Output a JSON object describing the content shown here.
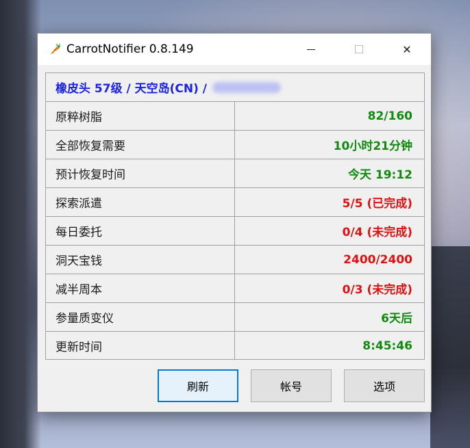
{
  "window": {
    "title": "CarrotNotifier 0.8.149",
    "controls": {
      "minimize": "minimize",
      "maximize": "maximize",
      "close": "✕"
    }
  },
  "header": {
    "text": "橡皮头 57级 / 天空岛(CN) /"
  },
  "rows": [
    {
      "label": "原粹树脂",
      "value": "82/160",
      "status": "green"
    },
    {
      "label": "全部恢复需要",
      "value": "10小时21分钟",
      "status": "green"
    },
    {
      "label": "预计恢复时间",
      "value": "今天 19:12",
      "status": "green"
    },
    {
      "label": "探索派遣",
      "value": "5/5 (已完成)",
      "status": "red"
    },
    {
      "label": "每日委托",
      "value": "0/4 (未完成)",
      "status": "red"
    },
    {
      "label": "洞天宝钱",
      "value": "2400/2400",
      "status": "red"
    },
    {
      "label": "减半周本",
      "value": "0/3 (未完成)",
      "status": "red"
    },
    {
      "label": "参量质变仪",
      "value": "6天后",
      "status": "green"
    },
    {
      "label": "更新时间",
      "value": "8:45:46",
      "status": "green"
    }
  ],
  "buttons": {
    "refresh": "刷新",
    "account": "帐号",
    "options": "选项"
  },
  "colors": {
    "header": "#1a22e6",
    "ok": "#0f8a0f",
    "alert": "#e01010",
    "focus_border": "#0078d7"
  },
  "icons": {
    "app": "carrot-icon",
    "minimize": "minimize-icon",
    "maximize": "maximize-icon",
    "close": "close-icon"
  }
}
